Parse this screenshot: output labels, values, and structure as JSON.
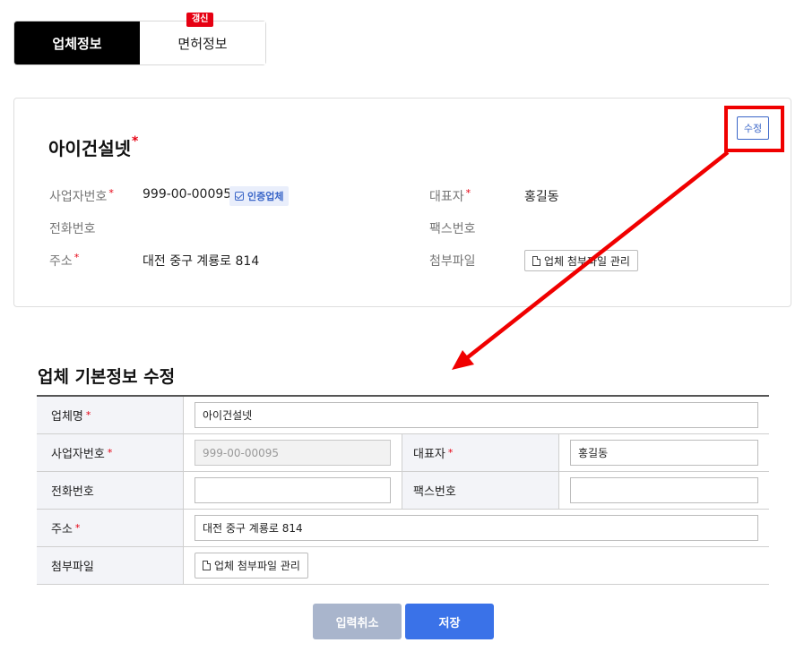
{
  "tabs": {
    "company_info": "업체정보",
    "license_info": "면허정보",
    "license_badge": "갱신"
  },
  "summary": {
    "company_name": "아이건설넷",
    "required_mark": "*",
    "edit_label": "수정",
    "biz_no_label": "사업자번호",
    "biz_no_value": "999-00-00095",
    "verified_label": "인증업체",
    "ceo_label": "대표자",
    "ceo_value": "홍길동",
    "phone_label": "전화번호",
    "phone_value": "",
    "fax_label": "팩스번호",
    "fax_value": "",
    "address_label": "주소",
    "address_value": "대전 중구 계룡로 814",
    "attach_label": "첨부파일",
    "attach_button": "업체 첨부파일 관리"
  },
  "form": {
    "title": "업체 기본정보 수정",
    "name_label": "업체명",
    "name_value": "아이건설넷",
    "biz_no_label": "사업자번호",
    "biz_no_value": "999-00-00095",
    "ceo_label": "대표자",
    "ceo_value": "홍길동",
    "phone_label": "전화번호",
    "phone_value": "",
    "fax_label": "팩스번호",
    "fax_value": "",
    "address_label": "주소",
    "address_value": "대전 중구 계룡로 814",
    "attach_label": "첨부파일",
    "attach_button": "업체 첨부파일 관리",
    "cancel_label": "입력취소",
    "save_label": "저장"
  },
  "icons": {
    "verified": "check-icon",
    "document": "document-icon"
  },
  "colors": {
    "accent_blue": "#3a72e8",
    "required_red": "#e60012",
    "annotation_red": "#f00000",
    "cancel_gray": "#a9b5cc"
  }
}
